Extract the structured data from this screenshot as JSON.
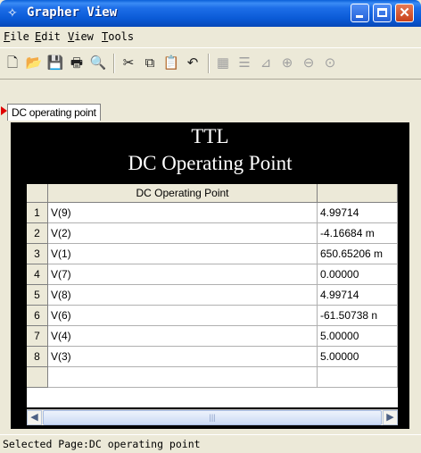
{
  "window": {
    "title": "Grapher View",
    "app_icon": "grapher-app-icon"
  },
  "menu": {
    "items": [
      "File",
      "Edit",
      "View",
      "Tools"
    ]
  },
  "toolbar": {
    "icons": [
      "new-icon",
      "open-icon",
      "save-icon",
      "print-icon",
      "print-preview-icon",
      "cut-icon",
      "copy-icon",
      "paste-icon",
      "undo-icon",
      "grid-icon",
      "list-icon",
      "chart-icon",
      "zoom-in-icon",
      "zoom-out-icon",
      "zoom-fit-icon"
    ]
  },
  "tabs": [
    {
      "label": "DC operating point",
      "active": true
    }
  ],
  "chart": {
    "title_line1": "TTL",
    "title_line2": "DC Operating Point"
  },
  "table": {
    "column_header": "DC Operating Point",
    "rows": [
      {
        "num": "1",
        "name": "V(9)",
        "value": "4.99714"
      },
      {
        "num": "2",
        "name": "V(2)",
        "value": "-4.16684 m"
      },
      {
        "num": "3",
        "name": "V(1)",
        "value": "650.65206 m"
      },
      {
        "num": "4",
        "name": "V(7)",
        "value": "0.00000"
      },
      {
        "num": "5",
        "name": "V(8)",
        "value": "4.99714"
      },
      {
        "num": "6",
        "name": "V(6)",
        "value": "-61.50738 n"
      },
      {
        "num": "7",
        "name": "V(4)",
        "value": "5.00000"
      },
      {
        "num": "8",
        "name": "V(3)",
        "value": "5.00000"
      }
    ]
  },
  "status": {
    "text": "Selected Page:DC operating point"
  },
  "colors": {
    "titlebar": "#0a5ad6",
    "chart_background": "#000000",
    "close_button": "#c8401a"
  }
}
